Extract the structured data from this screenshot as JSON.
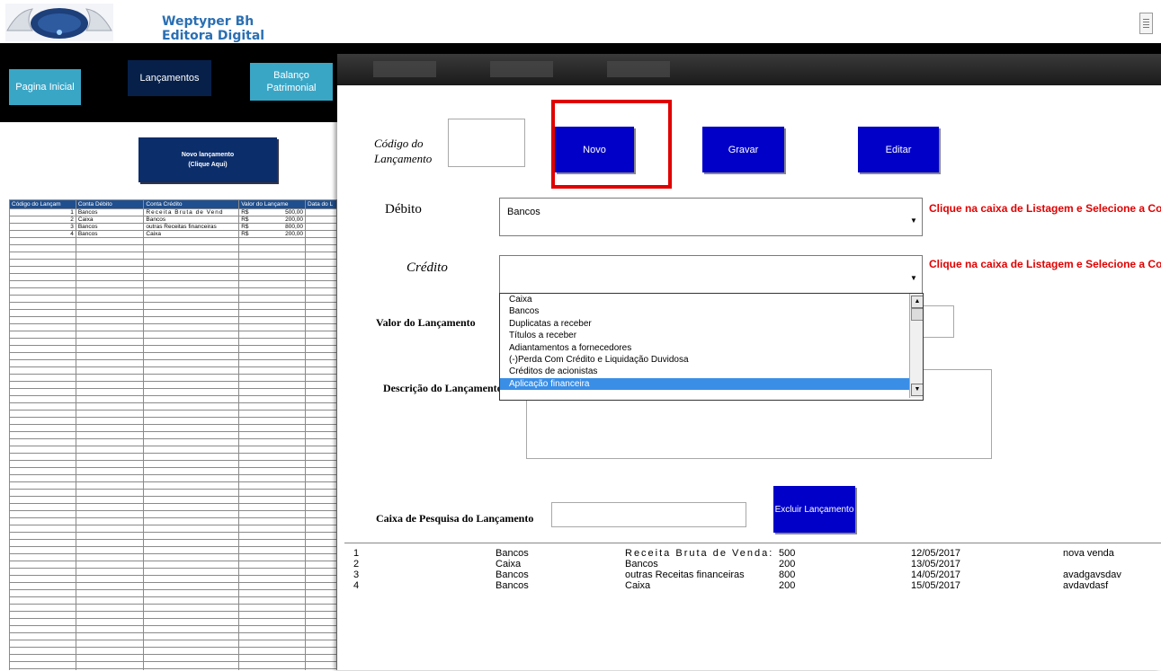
{
  "brand": {
    "line1": "Weptyper Bh",
    "line2": "Editora Digital"
  },
  "nav": {
    "pagina_inicial": "Pagina Inicial",
    "lancamentos": "Lançamentos",
    "balanco_line1": "Balanço",
    "balanco_line2": "Patrimonial"
  },
  "sheet": {
    "button_line1": "Novo lançamento",
    "button_line2": "(Clique Aqui)",
    "headers": [
      "Código do Lançam",
      "Conta Débito",
      "Conta Crédito",
      "Valor do Lançame",
      "Data do L"
    ],
    "rows": [
      {
        "codigo": "1",
        "debito": "Bancos",
        "credito": "Receita Bruta de Vend",
        "moeda": "R$",
        "valor": "500,00"
      },
      {
        "codigo": "2",
        "debito": "Caixa",
        "credito": "Bancos",
        "moeda": "R$",
        "valor": "200,00"
      },
      {
        "codigo": "3",
        "debito": "Bancos",
        "credito": "outras Receitas financeiras",
        "moeda": "R$",
        "valor": "800,00"
      },
      {
        "codigo": "4",
        "debito": "Bancos",
        "credito": "Caixa",
        "moeda": "R$",
        "valor": "200,00"
      }
    ]
  },
  "dialog": {
    "codigo_label_1": "Código do",
    "codigo_label_2": "Lançamento",
    "btn_novo": "Novo",
    "btn_gravar": "Gravar",
    "btn_editar": "Editar",
    "debito_label": "Débito",
    "debito_value": "Bancos",
    "credito_label": "Crédito",
    "credito_value": "",
    "hint": "Clique na caixa de Listagem e Selecione a Co",
    "valor_label": "Valor do Lançamento",
    "descricao_label": "Descrição do Lançamento",
    "pesquisa_label": "Caixa de Pesquisa  do Lançamento",
    "btn_excluir": "Excluir Lançamento",
    "listbox_items": [
      "Caixa",
      "Bancos",
      "Duplicatas a receber",
      "Títulos a receber",
      "Adiantamentos a fornecedores",
      "(-)Perda Com Crédito e Liquidação Duvidosa",
      "Créditos de acionistas",
      "Aplicação financeira"
    ],
    "listbox_selected": "Aplicação financeira"
  },
  "results": [
    {
      "codigo": "1",
      "debito": "Bancos",
      "credito": "Receita Bruta de Venda:",
      "valor": "500",
      "data": "12/05/2017",
      "descricao": "nova venda"
    },
    {
      "codigo": "2",
      "debito": "Caixa",
      "credito": "Bancos",
      "valor": "200",
      "data": "13/05/2017",
      "descricao": ""
    },
    {
      "codigo": "3",
      "debito": "Bancos",
      "credito": "outras Receitas  financeiras",
      "valor": "800",
      "data": "14/05/2017",
      "descricao": "avadgavsdav"
    },
    {
      "codigo": "4",
      "debito": "Bancos",
      "credito": "Caixa",
      "valor": "200",
      "data": "15/05/2017",
      "descricao": "avdavdasf"
    }
  ],
  "colors": {
    "nav_teal": "#3aa6c6",
    "nav_dark": "#06204a",
    "button_blue": "#0000c8",
    "hint_red": "#e00000",
    "highlight_red": "#e00000",
    "selection_blue": "#3a8ee6"
  }
}
